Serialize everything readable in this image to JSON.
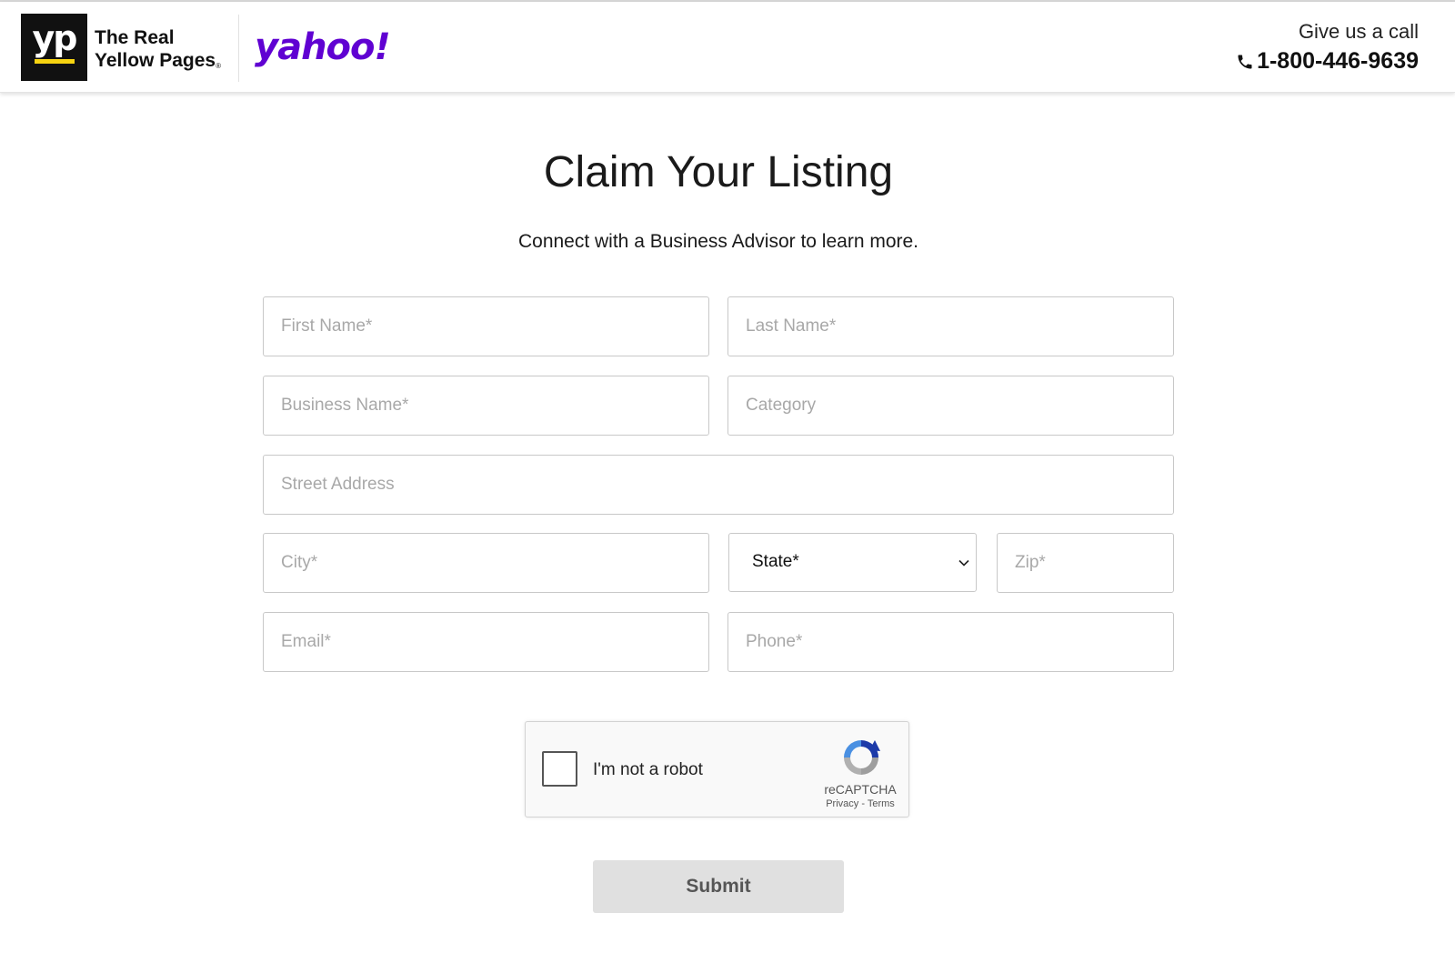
{
  "header": {
    "yp_letters": "yp",
    "brand_line1": "The Real",
    "brand_line2": "Yellow Pages",
    "brand_mark": "®",
    "partner_logo": "yahoo!",
    "call_label": "Give us a call",
    "call_number": "1-800-446-9639",
    "icons": {
      "phone": "phone-icon"
    }
  },
  "main": {
    "title": "Claim Your Listing",
    "subtitle": "Connect with a Business Advisor to learn more."
  },
  "form": {
    "first_name": {
      "placeholder": "First Name*",
      "value": ""
    },
    "last_name": {
      "placeholder": "Last Name*",
      "value": ""
    },
    "business_name": {
      "placeholder": "Business Name*",
      "value": ""
    },
    "category": {
      "placeholder": "Category",
      "value": ""
    },
    "street_address": {
      "placeholder": "Street Address",
      "value": ""
    },
    "city": {
      "placeholder": "City*",
      "value": ""
    },
    "state": {
      "selected": "State*"
    },
    "zip": {
      "placeholder": "Zip*",
      "value": ""
    },
    "email": {
      "placeholder": "Email*",
      "value": ""
    },
    "phone": {
      "placeholder": "Phone*",
      "value": ""
    },
    "submit_label": "Submit"
  },
  "captcha": {
    "label": "I'm not a robot",
    "brand": "reCAPTCHA",
    "links": "Privacy - Terms",
    "checked": false
  },
  "colors": {
    "yahoo_purple": "#6001d2",
    "yp_yellow": "#f6d311",
    "submit_disabled": "#e0e0e0"
  }
}
